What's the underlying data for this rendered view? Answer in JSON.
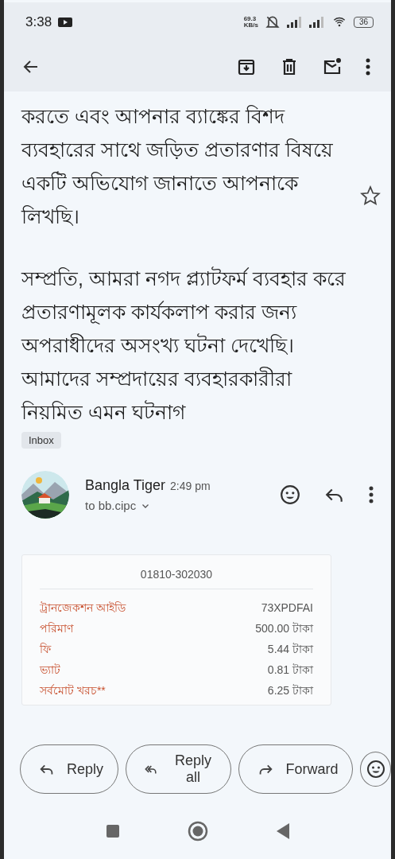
{
  "status_bar": {
    "time": "3:38",
    "net_speed": "69.3",
    "net_unit": "KB/s",
    "battery": "36"
  },
  "message": {
    "starred": false,
    "paragraphs": [
      "করতে এবং আপনার ব্যাঙ্কের বিশদ ব্যবহারের সাথে জড়িত প্রতারণার বিষয়ে একটি অভিযোগ জানাতে আপনাকে লিখছি।",
      "সম্প্রতি, আমরা নগদ প্ল্যাটফর্ম ব্যবহার করে প্রতারণামূলক কার্যকলাপ করার জন্য অপরাধীদের অসংখ্য ঘটনা দেখেছি। আমাদের সম্প্রদায়ের ব্যবহারকারীরা নিয়মিত এমন ঘটনাগ"
    ],
    "label": "Inbox"
  },
  "reply": {
    "sender": "Bangla Tiger",
    "time": "2:49 pm",
    "recipient": "to bb.cipc",
    "receipt": {
      "phone": "01810-302030",
      "rows": [
        {
          "label": "ট্রানজেকশন আইডি",
          "value": "73XPDFAI"
        },
        {
          "label": "পরিমাণ",
          "value": "500.00 টাকা"
        },
        {
          "label": "ফি",
          "value": "5.44 টাকা"
        },
        {
          "label": "ভ্যাট",
          "value": "0.81 টাকা"
        },
        {
          "label": "সর্বমোট খরচ**",
          "value": "6.25 টাকা"
        }
      ]
    }
  },
  "actions": [
    {
      "kind": "reply",
      "label": "Reply"
    },
    {
      "kind": "reply_all",
      "label": "Reply all"
    },
    {
      "kind": "forward",
      "label": "Forward"
    }
  ]
}
